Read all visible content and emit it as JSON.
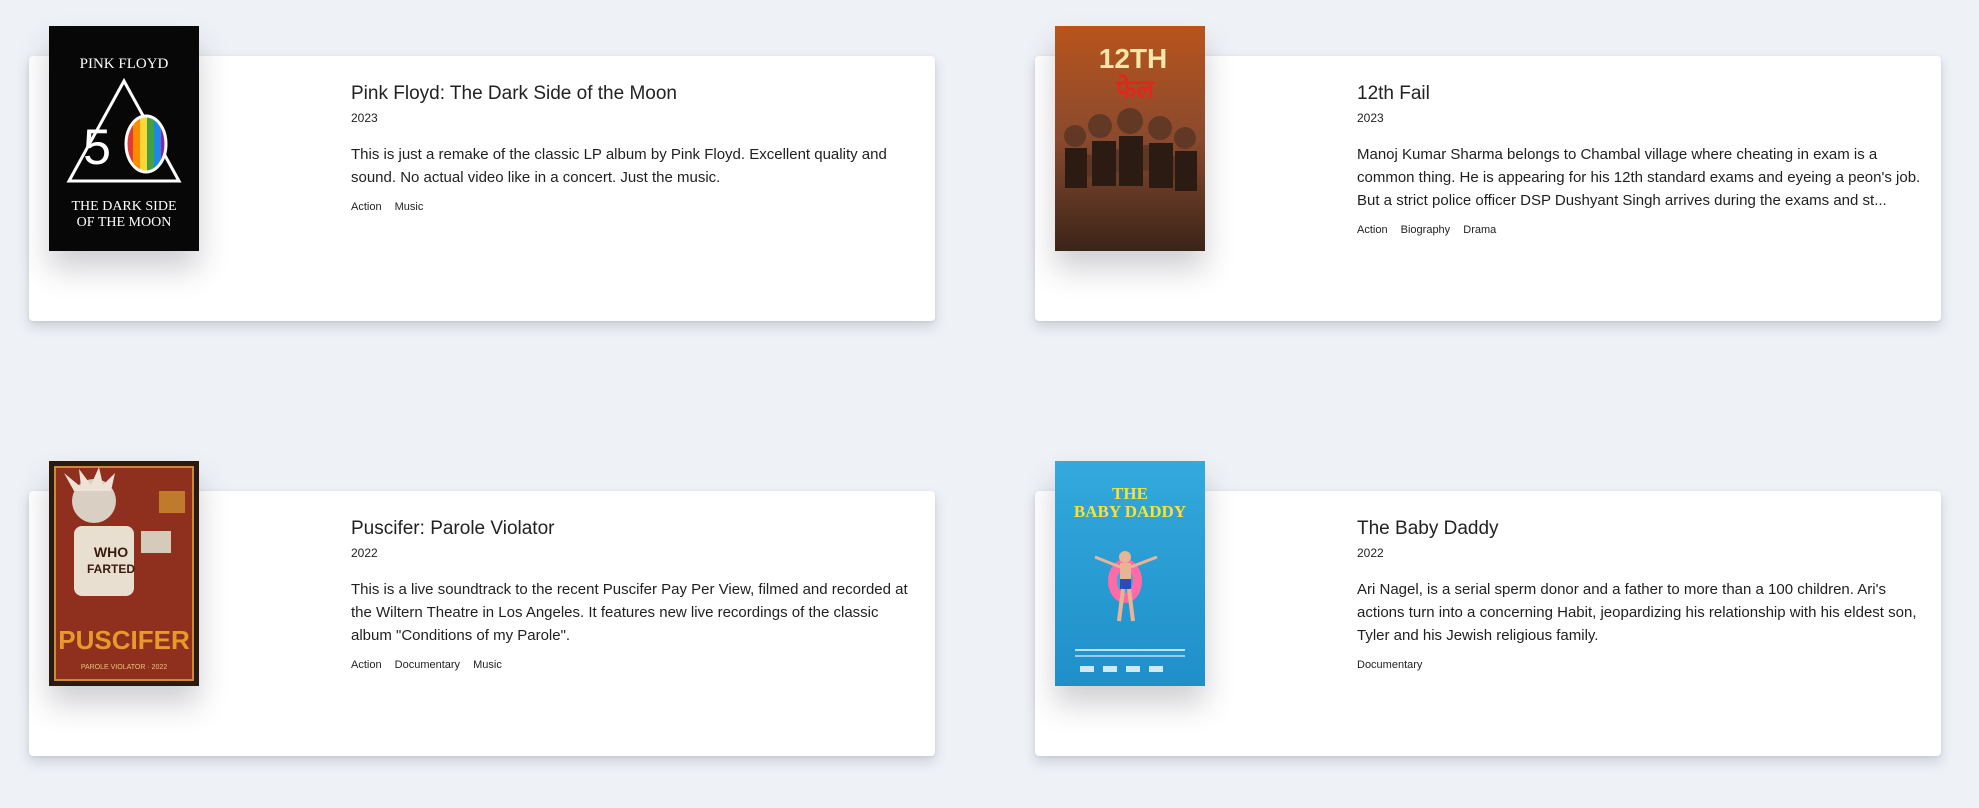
{
  "movies": [
    {
      "title": "Pink Floyd: The Dark Side of the Moon",
      "year": "2023",
      "description": "This is just a remake of the classic LP album by Pink Floyd. Excellent quality and sound. No actual video like in a concert. Just the music.",
      "genres": [
        "Action",
        "Music"
      ],
      "poster": {
        "top": "PINK FLOYD",
        "num": "50",
        "line1": "THE DARK SIDE",
        "line2": "OF THE MOON"
      }
    },
    {
      "title": "12th Fail",
      "year": "2023",
      "description": "Manoj Kumar Sharma belongs to Chambal village where cheating in exam is a common thing. He is appearing for his 12th standard exams and eyeing a peon's job. But a strict police officer DSP Dushyant Singh arrives during the exams and st...",
      "genres": [
        "Action",
        "Biography",
        "Drama"
      ],
      "poster": {
        "top": "12TH",
        "sub": "फेल"
      }
    },
    {
      "title": "Puscifer: Parole Violator",
      "year": "2022",
      "description": "This is a live soundtrack to the recent Puscifer Pay Per View, filmed and recorded at the Wiltern Theatre in Los Angeles. It features new live recordings of the classic album \"Conditions of my Parole\".",
      "genres": [
        "Action",
        "Documentary",
        "Music"
      ],
      "poster": {
        "shirt1": "WHO",
        "shirt2": "FARTED",
        "band": "PUSCIFER",
        "bottom": "PAROLE VIOLATOR · 2022"
      }
    },
    {
      "title": "The Baby Daddy",
      "year": "2022",
      "description": "Ari Nagel, is a serial sperm donor and a father to more than a 100 children. Ari's actions turn into a concerning Habit, jeopardizing his relationship with his eldest son, Tyler and his Jewish religious family.",
      "genres": [
        "Documentary"
      ],
      "poster": {
        "line1": "THE",
        "line2": "BABY DADDY"
      }
    }
  ],
  "colors": {
    "background": "#eef1f6",
    "card": "#ffffff",
    "text": "#1f1f1f"
  }
}
